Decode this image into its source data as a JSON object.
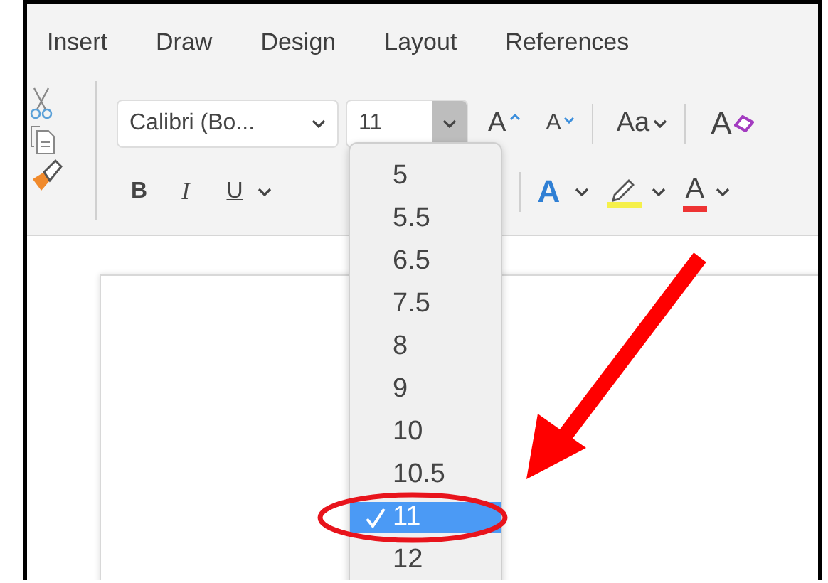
{
  "tabs": [
    {
      "label": "Insert"
    },
    {
      "label": "Draw"
    },
    {
      "label": "Design"
    },
    {
      "label": "Layout"
    },
    {
      "label": "References"
    }
  ],
  "font_name": {
    "value": "Calibri (Bo..."
  },
  "font_size": {
    "value": "11"
  },
  "row1_buttons": [
    {
      "kind": "grow",
      "label": "A"
    },
    {
      "kind": "shrink",
      "label": "A"
    },
    {
      "kind": "case",
      "label": "Aa"
    },
    {
      "kind": "clear",
      "label": "A"
    }
  ],
  "row2_buttons": [
    {
      "kind": "bold",
      "label": "B"
    },
    {
      "kind": "italic",
      "label": "I"
    },
    {
      "kind": "underline",
      "label": "U"
    },
    {
      "kind": "effects",
      "label": "A"
    },
    {
      "kind": "highlight"
    },
    {
      "kind": "color",
      "label": "A"
    }
  ],
  "size_menu": [
    {
      "label": "5",
      "selected": false
    },
    {
      "label": "5.5",
      "selected": false
    },
    {
      "label": "6.5",
      "selected": false
    },
    {
      "label": "7.5",
      "selected": false
    },
    {
      "label": "8",
      "selected": false
    },
    {
      "label": "9",
      "selected": false
    },
    {
      "label": "10",
      "selected": false
    },
    {
      "label": "10.5",
      "selected": false
    },
    {
      "label": "11",
      "selected": true
    },
    {
      "label": "12",
      "selected": false
    }
  ]
}
